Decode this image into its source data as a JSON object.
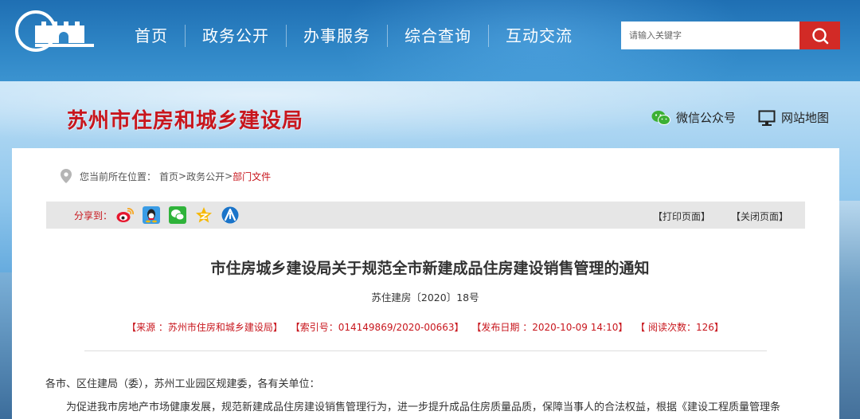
{
  "header": {
    "nav": [
      "首页",
      "政务公开",
      "办事服务",
      "综合查询",
      "互动交流"
    ],
    "search": {
      "placeholder": "请输入关键字"
    }
  },
  "banner": {
    "site_title": "苏州市住房和城乡建设局",
    "quick_links": [
      "微信公众号",
      "网站地图"
    ]
  },
  "location": {
    "label": "您当前所在位置：",
    "crumbs": [
      "首页",
      "政务公开",
      "部门文件"
    ],
    "separator": ">"
  },
  "share": {
    "label": "分享到：",
    "icons": [
      "weibo-icon",
      "qq-icon",
      "wechat-icon",
      "qzone-icon",
      "renren-icon"
    ],
    "print": "【打印页面】",
    "close": "【关闭页面】"
  },
  "article": {
    "title": "市住房城乡建设局关于规范全市新建成品住房建设销售管理的通知",
    "doc_number": "苏住建房〔2020〕18号",
    "meta": {
      "source": "【来源 ：苏州市住房和城乡建设局】",
      "index": "【索引号：014149869/2020-00663】",
      "date": "【发布日期 ：2020-10-09 14:10】",
      "views": "【 阅读次数：126】"
    },
    "paragraphs": [
      "各市、区住建局（委），苏州工业园区规建委，各有关单位：",
      "为促进我市房地产市场健康发展，规范新建成品住房建设销售管理行为，进一步提升成品住房质量品质，保障当事人的合法权益，根据《建设工程质量管理条"
    ]
  },
  "colors": {
    "brand_red": "#c8161d",
    "search_button": "#d22a26",
    "nav_blue": "#2f86c6"
  }
}
